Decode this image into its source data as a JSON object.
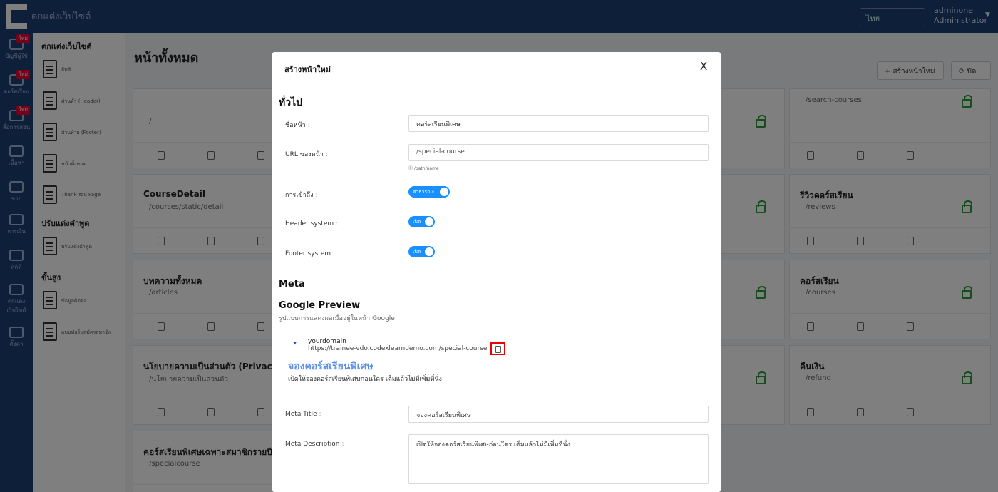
{
  "topbar": {
    "title": "ตกแต่งเว็บไซต์",
    "language": "ไทย",
    "user_name": "adminone",
    "user_role": "Administrator"
  },
  "rail": {
    "items": [
      {
        "label": "บัญชีผู้ใช้",
        "badge": "ใหม่",
        "icon": "users-icon"
      },
      {
        "label": "คอร์สเรียน",
        "badge": "ใหม่",
        "icon": "book-icon"
      },
      {
        "label": "สื่อการสอน",
        "badge": "ใหม่",
        "icon": "media-icon"
      },
      {
        "label": "เนื้อหา",
        "badge": "",
        "icon": "edit-icon"
      },
      {
        "label": "ขาย",
        "badge": "",
        "icon": "cart-icon"
      },
      {
        "label": "การเงิน",
        "badge": "",
        "icon": "money-icon"
      },
      {
        "label": "สถิติ",
        "badge": "",
        "icon": "chart-icon"
      },
      {
        "label": "ตกแต่งเว็บไซต์",
        "badge": "",
        "icon": "monitor-icon"
      },
      {
        "label": "ตั้งค่า",
        "badge": "",
        "icon": "gear-icon"
      }
    ]
  },
  "subnav": {
    "section1": "ตกแต่งเว็บไซต์",
    "items1": [
      "ธีมสี",
      "ส่วนหัว (Header)",
      "ส่วนท้าย (Footer)",
      "หน้าทั้งหมด",
      "Thank You Page"
    ],
    "section2": "ปรับแต่งคำพูด",
    "items2": [
      "ปรับแต่งคำพูด"
    ],
    "section3": "ขั้นสูง",
    "items3": [
      "ข้อมูลติดต่อ",
      "แบบฟอร์มสมัครสมาชิก"
    ]
  },
  "main": {
    "title": "หน้าทั้งหมด",
    "create_label": "+ สร้างหน้าใหม่",
    "back_label": "⟳ ปิด",
    "cards_left": [
      {
        "title": "",
        "path": "/"
      },
      {
        "title": "CourseDetail",
        "path": "/courses/static/detail"
      },
      {
        "title": "บทความทั้งหมด",
        "path": "/articles"
      },
      {
        "title": "นโยบายความเป็นส่วนตัว (Privacy Po",
        "path": "/นโยบายความเป็นส่วนตัว"
      },
      {
        "title": "คอร์สเรียนพิเศษเฉพาะสมาชิกรายปี",
        "path": "/specialcourse"
      }
    ],
    "cards_right": [
      {
        "title": "",
        "path": "/search-courses"
      },
      {
        "title": "รีวิวคอร์สเรียน",
        "path": "/reviews"
      },
      {
        "title": "คอร์สเรียน",
        "path": "/courses"
      },
      {
        "title": "คืนเงิน",
        "path": "/refund"
      }
    ]
  },
  "modal": {
    "title": "สร้างหน้าใหม่",
    "close": "X",
    "section_general": "ทั่วไป",
    "page_name_label": "ชื่อหน้า",
    "page_name_value": "คอร์สเรียนพิเศษ",
    "url_label": "URL ของหน้า",
    "url_value": "/special-course",
    "url_hint": "⓪ /path/name",
    "access_label": "การเข้าถึง",
    "access_toggle": "สาธารณะ",
    "header_label": "Header system",
    "header_toggle": "เปิด",
    "footer_label": "Footer system",
    "footer_toggle": "เปิด",
    "section_meta": "Meta",
    "google_preview_title": "Google Preview",
    "google_preview_sub": "รูปแบบการแสดงผลเมื่ออยู่ในหน้า Google",
    "preview_domain": "yourdomain",
    "preview_url": "https://trainee-vdo.codexlearndemo.com/special-course",
    "preview_headline": "จองคอร์สเรียนพิเศษ",
    "preview_desc": "เปิดให้จองคอร์สเรียนพิเศษก่อนใคร เต็มแล้วไม่มีเพิ่มที่นั่ง",
    "meta_title_label": "Meta Title",
    "meta_title_value": "จองคอร์สเรียนพิเศษ",
    "meta_desc_label": "Meta Description",
    "meta_desc_value": "เปิดให้จองคอร์สเรียนพิเศษก่อนใคร เต็มแล้วไม่มีเพิ่มที่นั่ง"
  }
}
